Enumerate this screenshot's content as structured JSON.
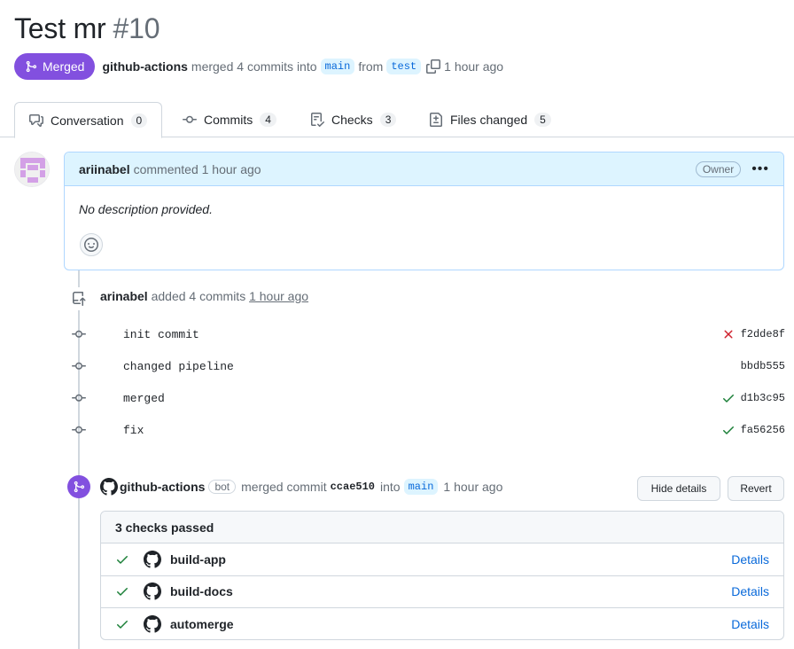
{
  "header": {
    "title": "Test mr",
    "number": "#10",
    "status": "Merged",
    "author": "github-actions",
    "merge_text": "merged 4 commits into",
    "base_branch": "main",
    "from_text": "from",
    "head_branch": "test",
    "time": "1 hour ago"
  },
  "tabs": [
    {
      "label": "Conversation",
      "count": "0",
      "icon": "comment-discussion-icon"
    },
    {
      "label": "Commits",
      "count": "4",
      "icon": "git-commit-icon"
    },
    {
      "label": "Checks",
      "count": "3",
      "icon": "checklist-icon"
    },
    {
      "label": "Files changed",
      "count": "5",
      "icon": "file-diff-icon"
    }
  ],
  "comment": {
    "author": "ariinabel",
    "action": "commented 1 hour ago",
    "badge": "Owner",
    "body": "No description provided."
  },
  "commits_event": {
    "author": "arinabel",
    "action": "added 4 commits",
    "time": "1 hour ago"
  },
  "commits": [
    {
      "message": "init commit",
      "sha": "f2dde8f",
      "status": "failure"
    },
    {
      "message": "changed pipeline",
      "sha": "bbdb555",
      "status": "none"
    },
    {
      "message": "merged",
      "sha": "d1b3c95",
      "status": "success"
    },
    {
      "message": "fix",
      "sha": "fa56256",
      "status": "success"
    }
  ],
  "merge_event": {
    "author": "github-actions",
    "bot": "bot",
    "action": "merged commit",
    "sha": "ccae510",
    "into": "into",
    "branch": "main",
    "time": "1 hour ago",
    "hide_details": "Hide details",
    "revert": "Revert"
  },
  "checks": {
    "summary": "3 checks passed",
    "items": [
      {
        "name": "build-app",
        "link": "Details"
      },
      {
        "name": "build-docs",
        "link": "Details"
      },
      {
        "name": "automerge",
        "link": "Details"
      }
    ]
  },
  "colors": {
    "merged": "#8250df",
    "success": "#1a7f37",
    "failure": "#cf222e",
    "link": "#0969da"
  }
}
